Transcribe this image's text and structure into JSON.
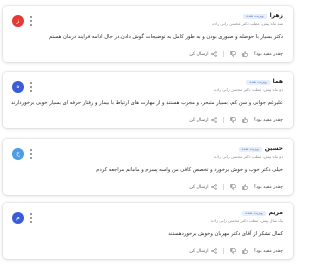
{
  "colors": {
    "avatar_red": "#e53935",
    "avatar_blue": "#3c5bd8",
    "avatar_lightblue": "#4e9be8",
    "badge_bg": "#e7eefb",
    "badge_text": "#5a7cc8"
  },
  "common": {
    "badge_label": "ویزیت شده",
    "helpful_question": "چقدر مفید بود؟",
    "send_label": "ارسال کن"
  },
  "reviews": [
    {
      "author": "زهرا",
      "avatar_letter": "ز",
      "avatar_color": "#e53935",
      "meta": "سه ماه پیش، مطب دکتر محسن رانی زاده",
      "text": "دکتر بسیار با حوصله و صبوری بودن و به طور کامل به توضیحات گوش دادن.در حال ادامه فرایند درمان هستم",
      "icons": [
        "like-icon",
        "dislike-icon",
        "share-icon"
      ]
    },
    {
      "author": "هما",
      "avatar_letter": "ه",
      "avatar_color": "#3c5bd8",
      "meta": "دو ماه پیش، مطب دکتر محسن رانی زاده",
      "text": "علیرغم جوانی و سن کم، بسیار متبحر، و مجرب هستند و از مهارت های ارتباط با بیمار و رفتار حرفه ای بسیار خوبی برخوردارند",
      "icons": [
        "like-icon",
        "dislike-icon",
        "share-icon"
      ]
    },
    {
      "author": "حسین",
      "avatar_letter": "ح",
      "avatar_color": "#4e9be8",
      "meta": "دو ماه پیش، مطب دکتر محسن رانی زاده",
      "text": "خیلی دکتر خوب و خوش برخورد و تخصص کافی من واسه پسرم و مامانم مراجعه کردم",
      "icons": [
        "like-icon",
        "dislike-icon",
        "share-icon"
      ]
    },
    {
      "author": "مریم",
      "avatar_letter": "م",
      "avatar_color": "#3c5bd8",
      "meta": "یک سال پیش، مطب دکتر محسن رانی زاده",
      "text": "کمال تشکر از آقای دکتر مهربان وخوش برخوردهستند",
      "icons": [
        "like-icon",
        "dislike-icon",
        "share-icon"
      ]
    }
  ]
}
